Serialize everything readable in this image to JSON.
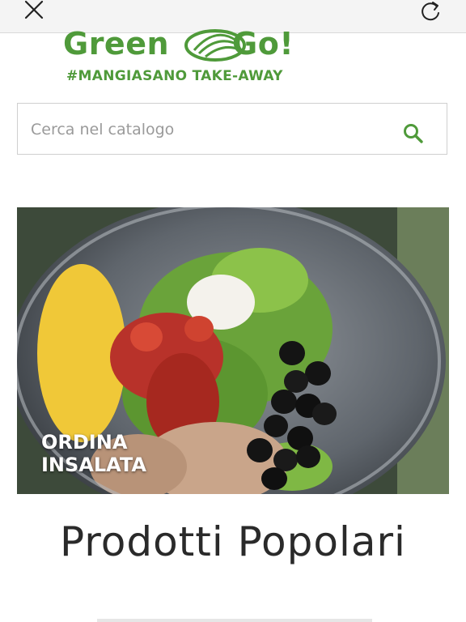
{
  "browser": {
    "close_icon": "close-icon",
    "reload_icon": "reload-icon"
  },
  "logo": {
    "brand_left": "Green",
    "brand_right": "Go!",
    "tagline": "#MANGIASANO TAKE-AWAY",
    "color": "#4f9a3a"
  },
  "search": {
    "placeholder": "Cerca nel catalogo",
    "value": "",
    "icon": "search-icon",
    "icon_color": "#4f9a3a"
  },
  "banner": {
    "label": "ORDINA\nINSALATA"
  },
  "sections": {
    "popular_title": "Prodotti Popolari"
  }
}
